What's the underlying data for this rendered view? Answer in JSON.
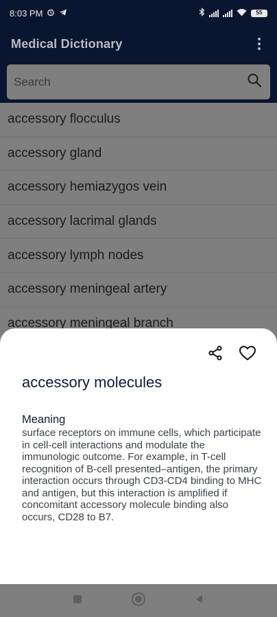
{
  "status": {
    "time": "8:03 PM",
    "battery": "55"
  },
  "app": {
    "title": "Medical Dictionary"
  },
  "search": {
    "placeholder": "Search"
  },
  "list": {
    "items": [
      "accessory flocculus",
      "accessory gland",
      "accessory hemiazygos vein",
      "accessory lacrimal glands",
      "accessory lymph nodes",
      "accessory meningeal artery",
      "accessory meningeal branch"
    ]
  },
  "sheet": {
    "term": "accessory molecules",
    "meaning_label": "Meaning",
    "meaning": "surface receptors on immune cells, which participate in cell-cell interactions and modulate the immunologic outcome. For example, in T-cell recognition of B-cell presented–antigen, the primary interaction occurs through CD3-CD4 binding to MHC and antigen, but this interaction is amplified if concomitant accessory molecule binding also occurs, CD28 to B7."
  },
  "icons": {
    "search": "search-icon",
    "share": "share-icon",
    "favorite": "heart-icon",
    "more": "more-vert-icon"
  },
  "colors": {
    "primary": "#0a1630",
    "accent_text": "#0e1a36"
  }
}
